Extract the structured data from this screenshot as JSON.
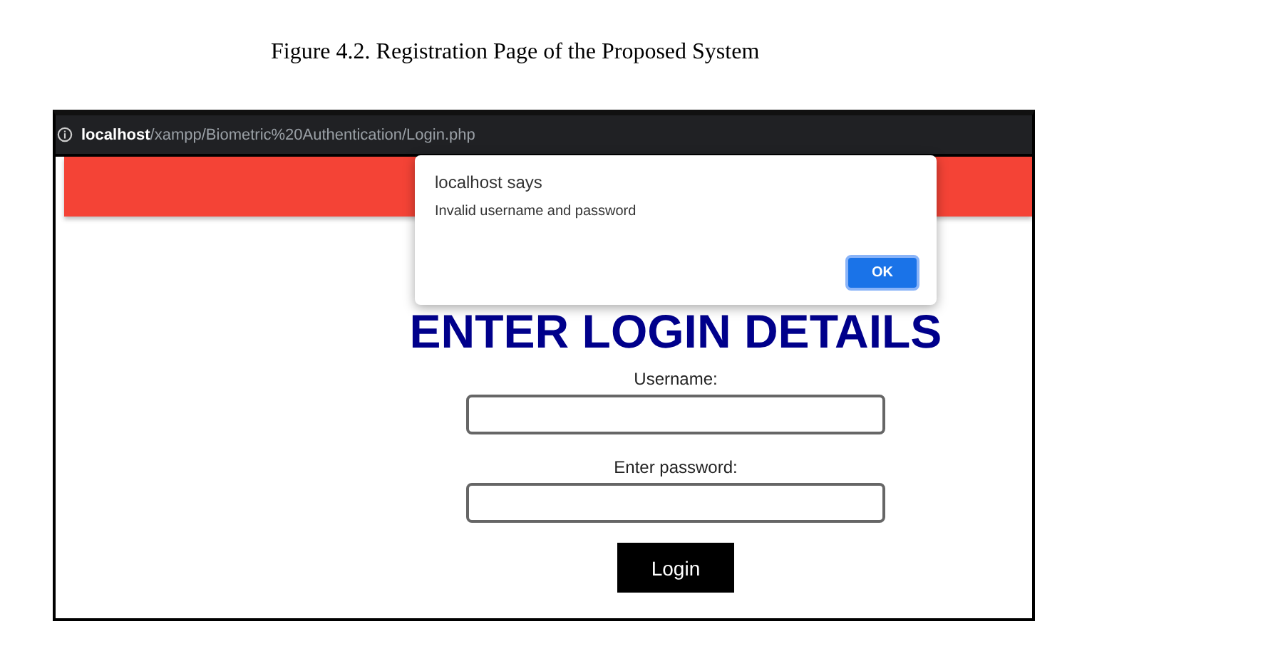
{
  "caption": "Figure 4.2. Registration Page of the Proposed System",
  "browser": {
    "url": "**localhost**/xampp/Biometric%20Authentication/Login.php"
  },
  "page": {
    "heading": "ENTER LOGIN DETAILS",
    "fields": [
      {
        "label": "Username:"
      },
      {
        "label": "Enter password:"
      }
    ],
    "button": "Login"
  },
  "dialog": {
    "title": "localhost says",
    "message": "Invalid username and password",
    "button": "OK"
  }
}
